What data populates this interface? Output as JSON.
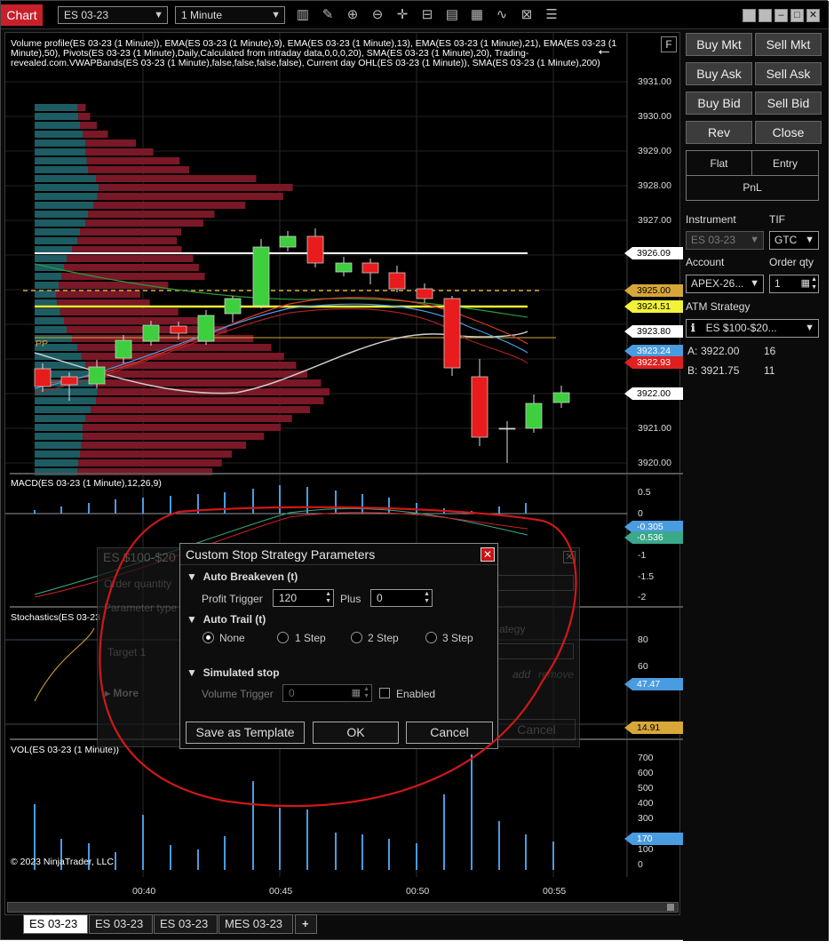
{
  "app": {
    "title": "Chart"
  },
  "toolbar": {
    "instrument": "ES 03-23",
    "interval": "1 Minute",
    "icons": [
      "bars-icon",
      "pencil-icon",
      "zoom-in-icon",
      "zoom-out-icon",
      "crosshair-icon",
      "data-box-icon",
      "indicators-icon",
      "strategies-icon",
      "drawing-tools-icon",
      "properties-icon"
    ]
  },
  "chart": {
    "title_lines": [
      "Volume profile(ES 03-23 (1 Minute)), EMA(ES 03-23 (1 Minute),9), EMA(ES 03-23 (1 Minute),13), EMA(ES 03-23 (1 Minute),21), EMA(ES 03-23 (1",
      "Minute),50), Pivots(ES 03-23 (1 Minute),Daily,Calculated from intraday data,0,0,0,20), SMA(ES 03-23 (1 Minute),20), Trading-",
      "revealed.com.VWAPBands(ES 03-23 (1 Minute),false,false,false,false), Current day OHL(ES 03-23 (1 Minute)), SMA(ES 03-23 (1 Minute),200)"
    ],
    "f_button": "F",
    "pp_label": "PP",
    "price_labels": [
      "3931.00",
      "3930.00",
      "3929.00",
      "3928.00",
      "3927.00",
      "3921.00",
      "3920.00"
    ],
    "price_tags": [
      {
        "text": "3926.09",
        "color": "#ffffff"
      },
      {
        "text": "3925.00",
        "color": "#d8a73a"
      },
      {
        "text": "3924.51",
        "color": "#f2f23a"
      },
      {
        "text": "3923.80",
        "color": "#ffffff"
      },
      {
        "text": "3923.24",
        "color": "#4a9ce0"
      },
      {
        "text": "3922.93",
        "color": "#e02020"
      },
      {
        "text": "3922.00",
        "color": "#ffffff"
      }
    ],
    "macd": {
      "title": "MACD(ES 03-23 (1 Minute),12,26,9)",
      "labels": [
        "0.5",
        "0",
        "-1",
        "-1.5",
        "-2"
      ],
      "tags": [
        {
          "text": "-0.305",
          "color": "#4a9ce0"
        },
        {
          "text": "-0.536",
          "color": "#3aa88a"
        }
      ]
    },
    "stoch": {
      "title": "Stochastics(ES 03-23",
      "labels": [
        "80",
        "60"
      ],
      "tags": [
        {
          "text": "47.47",
          "color": "#4a9ce0"
        },
        {
          "text": "14.91",
          "color": "#d8a73a"
        }
      ]
    },
    "vol": {
      "title": "VOL(ES 03-23 (1 Minute))",
      "labels": [
        "700",
        "600",
        "500",
        "400",
        "300",
        "200",
        "100",
        "0"
      ],
      "tag": "170"
    },
    "copyright": "© 2023 NinjaTrader, LLC",
    "time_labels": [
      "00:40",
      "00:45",
      "00:50",
      "00:55"
    ]
  },
  "background_dialog": {
    "title": "ES $100-$20",
    "order_quantity": "Order quantity",
    "parameter_type": "Parameter type",
    "target1": "Target 1",
    "more": "More",
    "strategy": "ategy",
    "add": "add",
    "remove": "remove",
    "cancel": "Cancel"
  },
  "dialog": {
    "title": "Custom Stop Strategy Parameters",
    "auto_breakeven": "Auto Breakeven (t)",
    "profit_trigger_label": "Profit Trigger",
    "profit_trigger_value": "120",
    "plus_label": "Plus",
    "plus_value": "0",
    "auto_trail": "Auto Trail (t)",
    "radios": [
      "None",
      "1 Step",
      "2 Step",
      "3 Step"
    ],
    "selected": "None",
    "simulated_stop": "Simulated stop",
    "volume_trigger_label": "Volume Trigger",
    "volume_trigger_value": "0",
    "enabled_label": "Enabled",
    "save_template": "Save as Template",
    "ok": "OK",
    "cancel": "Cancel"
  },
  "trade_panel": {
    "buttons": [
      "Buy Mkt",
      "Sell Mkt",
      "Buy Ask",
      "Sell Ask",
      "Buy Bid",
      "Sell Bid",
      "Rev",
      "Close"
    ],
    "position": {
      "flat": "Flat",
      "entry": "Entry",
      "pnl": "PnL"
    },
    "instrument_label": "Instrument",
    "instrument_value": "ES 03-23",
    "tif_label": "TIF",
    "tif_value": "GTC",
    "account_label": "Account",
    "account_value": "APEX-26...",
    "orderqty_label": "Order qty",
    "orderqty_value": "1",
    "atm_label": "ATM Strategy",
    "atm_value": "ES $100-$20...",
    "ask_label": "A:",
    "ask_price": "3922.00",
    "ask_size": "16",
    "bid_label": "B:",
    "bid_price": "3921.75",
    "bid_size": "11"
  },
  "tabs": [
    "ES 03-23",
    "ES 03-23",
    "ES 03-23",
    "MES 03-23"
  ],
  "add_tab": "+"
}
